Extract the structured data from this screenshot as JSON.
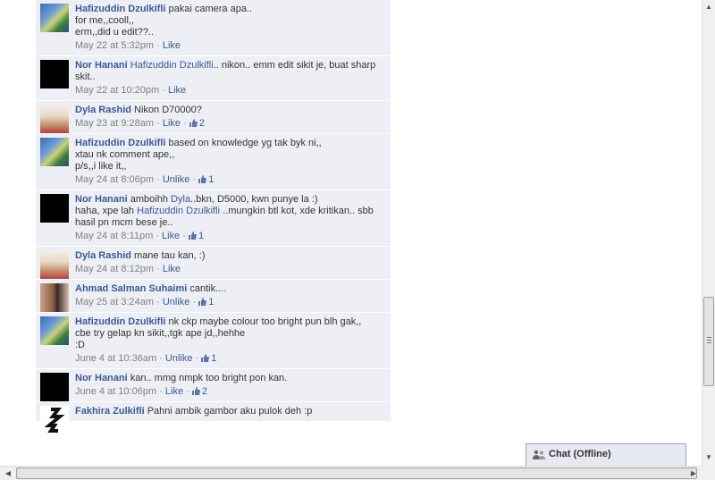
{
  "comments": [
    {
      "author": "Hafizuddin Dzulkifli",
      "avatar": "hafizuddin-avatar",
      "segments": [
        {
          "t": "pakai camera apa..\nfor me,,cooll,,\nerm,,did u edit??.."
        }
      ],
      "time": "May 22 at 5:32pm",
      "action": "Like",
      "likes": ""
    },
    {
      "author": "Nor Hanani",
      "avatar": "nor-hanani-avatar",
      "segments": [
        {
          "t": "Hafizuddin Dzulkifli",
          "m": true
        },
        {
          "t": ".. nikon.. emm edit sikit je, buat sharp skit.."
        }
      ],
      "time": "May 22 at 10:20pm",
      "action": "Like",
      "likes": ""
    },
    {
      "author": "Dyla Rashid",
      "avatar": "dyla-avatar",
      "segments": [
        {
          "t": "Nikon D70000?"
        }
      ],
      "time": "May 23 at 9:28am",
      "action": "Like",
      "likes": "2"
    },
    {
      "author": "Hafizuddin Dzulkifli",
      "avatar": "hafizuddin-avatar",
      "segments": [
        {
          "t": "based on knowledge yg tak byk ni,,\nxtau nk comment ape,,\np/s,,i like it,,"
        }
      ],
      "time": "May 24 at 8:06pm",
      "action": "Unlike",
      "likes": "1"
    },
    {
      "author": "Nor Hanani",
      "avatar": "nor-hanani-avatar",
      "segments": [
        {
          "t": "amboihh "
        },
        {
          "t": "Dyla",
          "m": true
        },
        {
          "t": "..bkn, D5000, kwn punye la :)\nhaha, xpe lah "
        },
        {
          "t": "Hafizuddin Dzulkifli",
          "m": true
        },
        {
          "t": " ..mungkin btl kot, xde kritikan.. sbb hasil pn mcm bese je.."
        }
      ],
      "time": "May 24 at 8:11pm",
      "action": "Like",
      "likes": "1"
    },
    {
      "author": "Dyla Rashid",
      "avatar": "dyla-avatar",
      "segments": [
        {
          "t": "mane tau kan, :)"
        }
      ],
      "time": "May 24 at 8:12pm",
      "action": "Like",
      "likes": ""
    },
    {
      "author": "Ahmad Salman Suhaimi",
      "avatar": "ahmad-avatar",
      "segments": [
        {
          "t": "cantik...."
        }
      ],
      "time": "May 25 at 3:24am",
      "action": "Unlike",
      "likes": "1"
    },
    {
      "author": "Hafizuddin Dzulkifli",
      "avatar": "hafizuddin-avatar",
      "segments": [
        {
          "t": "nk ckp maybe colour too bright pun blh gak,,\ncbe try gelap kn sikit,,tgk ape jd,,hehhe\n:D"
        }
      ],
      "time": "June 4 at 10:36am",
      "action": "Unlike",
      "likes": "1"
    },
    {
      "author": "Nor Hanani",
      "avatar": "nor-hanani-avatar",
      "segments": [
        {
          "t": "kan.. mmg nmpk too bright pon kan."
        }
      ],
      "time": "June 4 at 10:06pm",
      "action": "Like",
      "likes": "2"
    },
    {
      "author": "Fakhira Zulkifli",
      "avatar": "fakhira-avatar",
      "segments": [
        {
          "t": "Pahni ambik gambor aku pulok deh :p"
        }
      ],
      "time": "",
      "action": "",
      "likes": ""
    }
  ],
  "chat": {
    "label": "Chat (Offline)"
  },
  "colors": {
    "link": "#3b5998",
    "comment_bg": "#edeff4",
    "meta": "#808080"
  }
}
